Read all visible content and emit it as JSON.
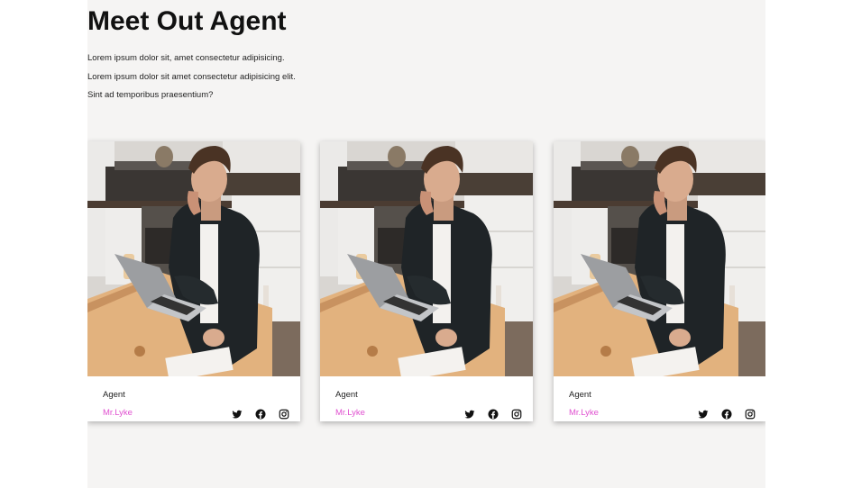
{
  "page": {
    "title": "Meet Out Agent",
    "intro": [
      "Lorem ipsum dolor sit, amet consectetur adipisicing.",
      "Lorem ipsum dolor sit amet consectetur adipisicing elit.",
      "Sint ad temporibus praesentium?"
    ]
  },
  "cards": [
    {
      "role": "Agent",
      "name": "Mr.Lyke",
      "socials": [
        "twitter-icon",
        "facebook-icon",
        "instagram-icon"
      ]
    },
    {
      "role": "Agent",
      "name": "Mr.Lyke",
      "socials": [
        "twitter-icon",
        "facebook-icon",
        "instagram-icon"
      ]
    },
    {
      "role": "Agent",
      "name": "Mr.Lyke",
      "socials": [
        "twitter-icon",
        "facebook-icon",
        "instagram-icon"
      ]
    }
  ],
  "colors": {
    "background": "#f5f4f3",
    "name_accent": "#e050d0",
    "icon": "#111111"
  }
}
